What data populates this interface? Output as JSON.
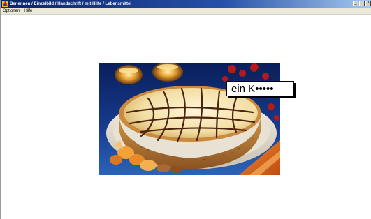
{
  "window": {
    "title": "Benennen / Einzelbild / Handschrift / mit Hilfe / Lebensmittel",
    "controls": {
      "minimize": "_",
      "maximize": "□",
      "close": "×"
    }
  },
  "menu": {
    "items": [
      "Optionen",
      "Hilfe"
    ]
  },
  "stimulus": {
    "icon": "cake-photo"
  },
  "answer": {
    "text": "ein K•••••"
  },
  "colors": {
    "titlebar_start": "#0a246a",
    "titlebar_end": "#a6caf0",
    "menubar": "#ece9d8",
    "background": "#ffffff"
  }
}
